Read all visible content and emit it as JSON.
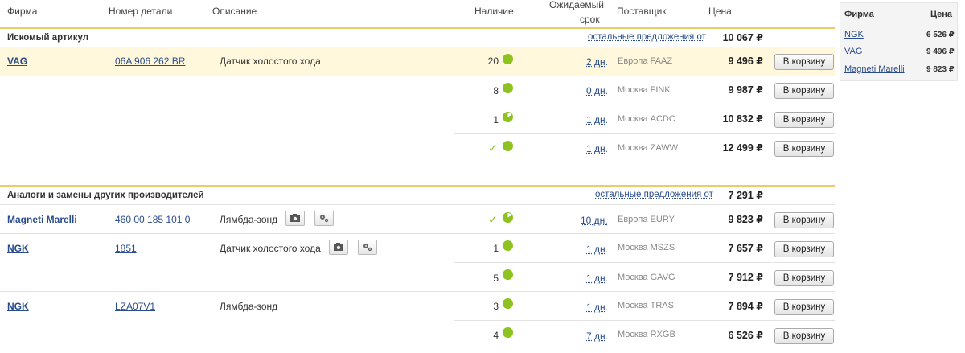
{
  "headers": {
    "brand": "Фирма",
    "part_no": "Номер детали",
    "description": "Описание",
    "stock": "Наличие",
    "expected_1": "Ожидаемый",
    "expected_2": "срок",
    "supplier": "Поставщик",
    "price": "Цена"
  },
  "cart_label": "В корзину",
  "icons": {
    "stock_ok": "green-dot-icon",
    "partial": "partial-dot-icon",
    "check": "check-icon",
    "photo": "camera-icon",
    "settings": "gears-icon"
  },
  "colors": {
    "accent_line": "#f0c96a",
    "highlight_row": "#fff8dc",
    "stock_green": "#8dc21f",
    "link": "#2a4c8a"
  },
  "section1": {
    "title": "Искомый артикул",
    "other_offers": "остальные предложения от",
    "other_price": "10 067 ₽",
    "brand": "VAG",
    "part_no": "06A 906 262 BR",
    "description": "Датчик холостого хода",
    "offers": [
      {
        "qty": "20",
        "days": "2 дн.",
        "supplier": "Европа FAAZ",
        "price": "9 496 ₽"
      },
      {
        "qty": "8",
        "days": "0 дн.",
        "supplier": "Москва FINK",
        "price": "9 987 ₽"
      },
      {
        "qty": "1",
        "days": "1 дн.",
        "supplier": "Москва ACDC",
        "price": "10 832 ₽"
      },
      {
        "qty": "",
        "days": "1 дн.",
        "supplier": "Москва ZAWW",
        "price": "12 499 ₽"
      }
    ]
  },
  "section2": {
    "title": "Аналоги и замены других производителей",
    "other_offers": "остальные предложения от",
    "other_price": "7 291 ₽",
    "items": [
      {
        "brand": "Magneti Marelli",
        "part_no": "460 00 185 101 0",
        "description": "Лямбда-зонд",
        "offers": [
          {
            "qty": "",
            "days": "10 дн.",
            "supplier": "Европа EURY",
            "price": "9 823 ₽"
          }
        ]
      },
      {
        "brand": "NGK",
        "part_no": "1851",
        "description": "Датчик холостого хода",
        "offers": [
          {
            "qty": "1",
            "days": "1 дн.",
            "supplier": "Москва MSZS",
            "price": "7 657 ₽"
          },
          {
            "qty": "5",
            "days": "1 дн.",
            "supplier": "Москва GAVG",
            "price": "7 912 ₽"
          }
        ]
      },
      {
        "brand": "NGK",
        "part_no": "LZA07V1",
        "description": "Лямбда-зонд",
        "offers": [
          {
            "qty": "3",
            "days": "1 дн.",
            "supplier": "Москва TRAS",
            "price": "7 894 ₽"
          },
          {
            "qty": "4",
            "days": "7 дн.",
            "supplier": "Москва RXGB",
            "price": "6 526 ₽"
          }
        ]
      }
    ]
  },
  "sidebar": {
    "brand_header": "Фирма",
    "price_header": "Цена",
    "items": [
      {
        "brand": "NGK",
        "price": "6 526 ₽"
      },
      {
        "brand": "VAG",
        "price": "9 496 ₽"
      },
      {
        "brand": "Magneti Marelli",
        "price": "9 823 ₽"
      }
    ]
  }
}
